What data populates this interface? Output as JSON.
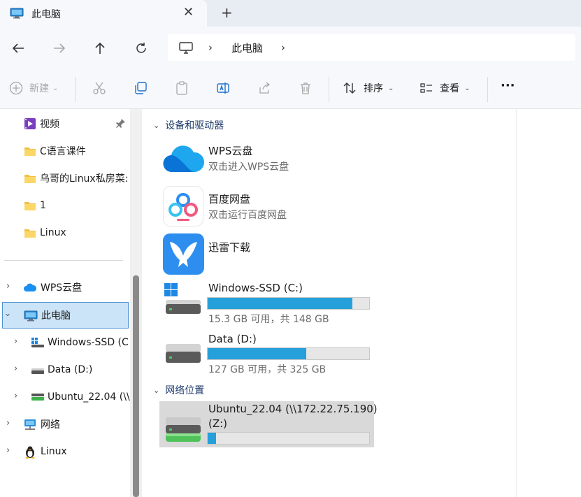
{
  "tab": {
    "title": "此电脑",
    "close": "✕",
    "new_tab": "+"
  },
  "address": {
    "crumb": "此电脑"
  },
  "toolbar": {
    "new_label": "新建",
    "sort_label": "排序",
    "view_label": "查看",
    "more": "···"
  },
  "sidebar": {
    "items": [
      {
        "label": "视频"
      },
      {
        "label": "C语言课件"
      },
      {
        "label": "乌哥的Linux私房菜:"
      },
      {
        "label": "1"
      },
      {
        "label": "Linux"
      },
      {
        "label": "WPS云盘"
      },
      {
        "label": "此电脑"
      },
      {
        "label": "Windows-SSD (C"
      },
      {
        "label": "Data (D:)"
      },
      {
        "label": "Ubuntu_22.04 (\\\\"
      },
      {
        "label": "网络"
      },
      {
        "label": "Linux"
      }
    ]
  },
  "main": {
    "section_devices": "设备和驱动器",
    "section_network": "网络位置",
    "apps": [
      {
        "name": "WPS云盘",
        "sub": "双击进入WPS云盘"
      },
      {
        "name": "百度网盘",
        "sub": "双击运行百度网盘"
      },
      {
        "name": "迅雷下载",
        "sub": ""
      }
    ],
    "drives": [
      {
        "name": "Windows-SSD (C:)",
        "info": "15.3 GB 可用，共 148 GB",
        "used_fraction": 0.897
      },
      {
        "name": "Data (D:)",
        "info": "127 GB 可用，共 325 GB",
        "used_fraction": 0.609
      }
    ],
    "network": [
      {
        "name_line1": "Ubuntu_22.04 (\\\\172.22.75.190)",
        "name_line2": "(Z:)",
        "used_fraction": 0.05
      }
    ]
  },
  "colors": {
    "accent": "#26a0da",
    "selection": "#cce4f7",
    "selection_border": "#4f94d4"
  }
}
